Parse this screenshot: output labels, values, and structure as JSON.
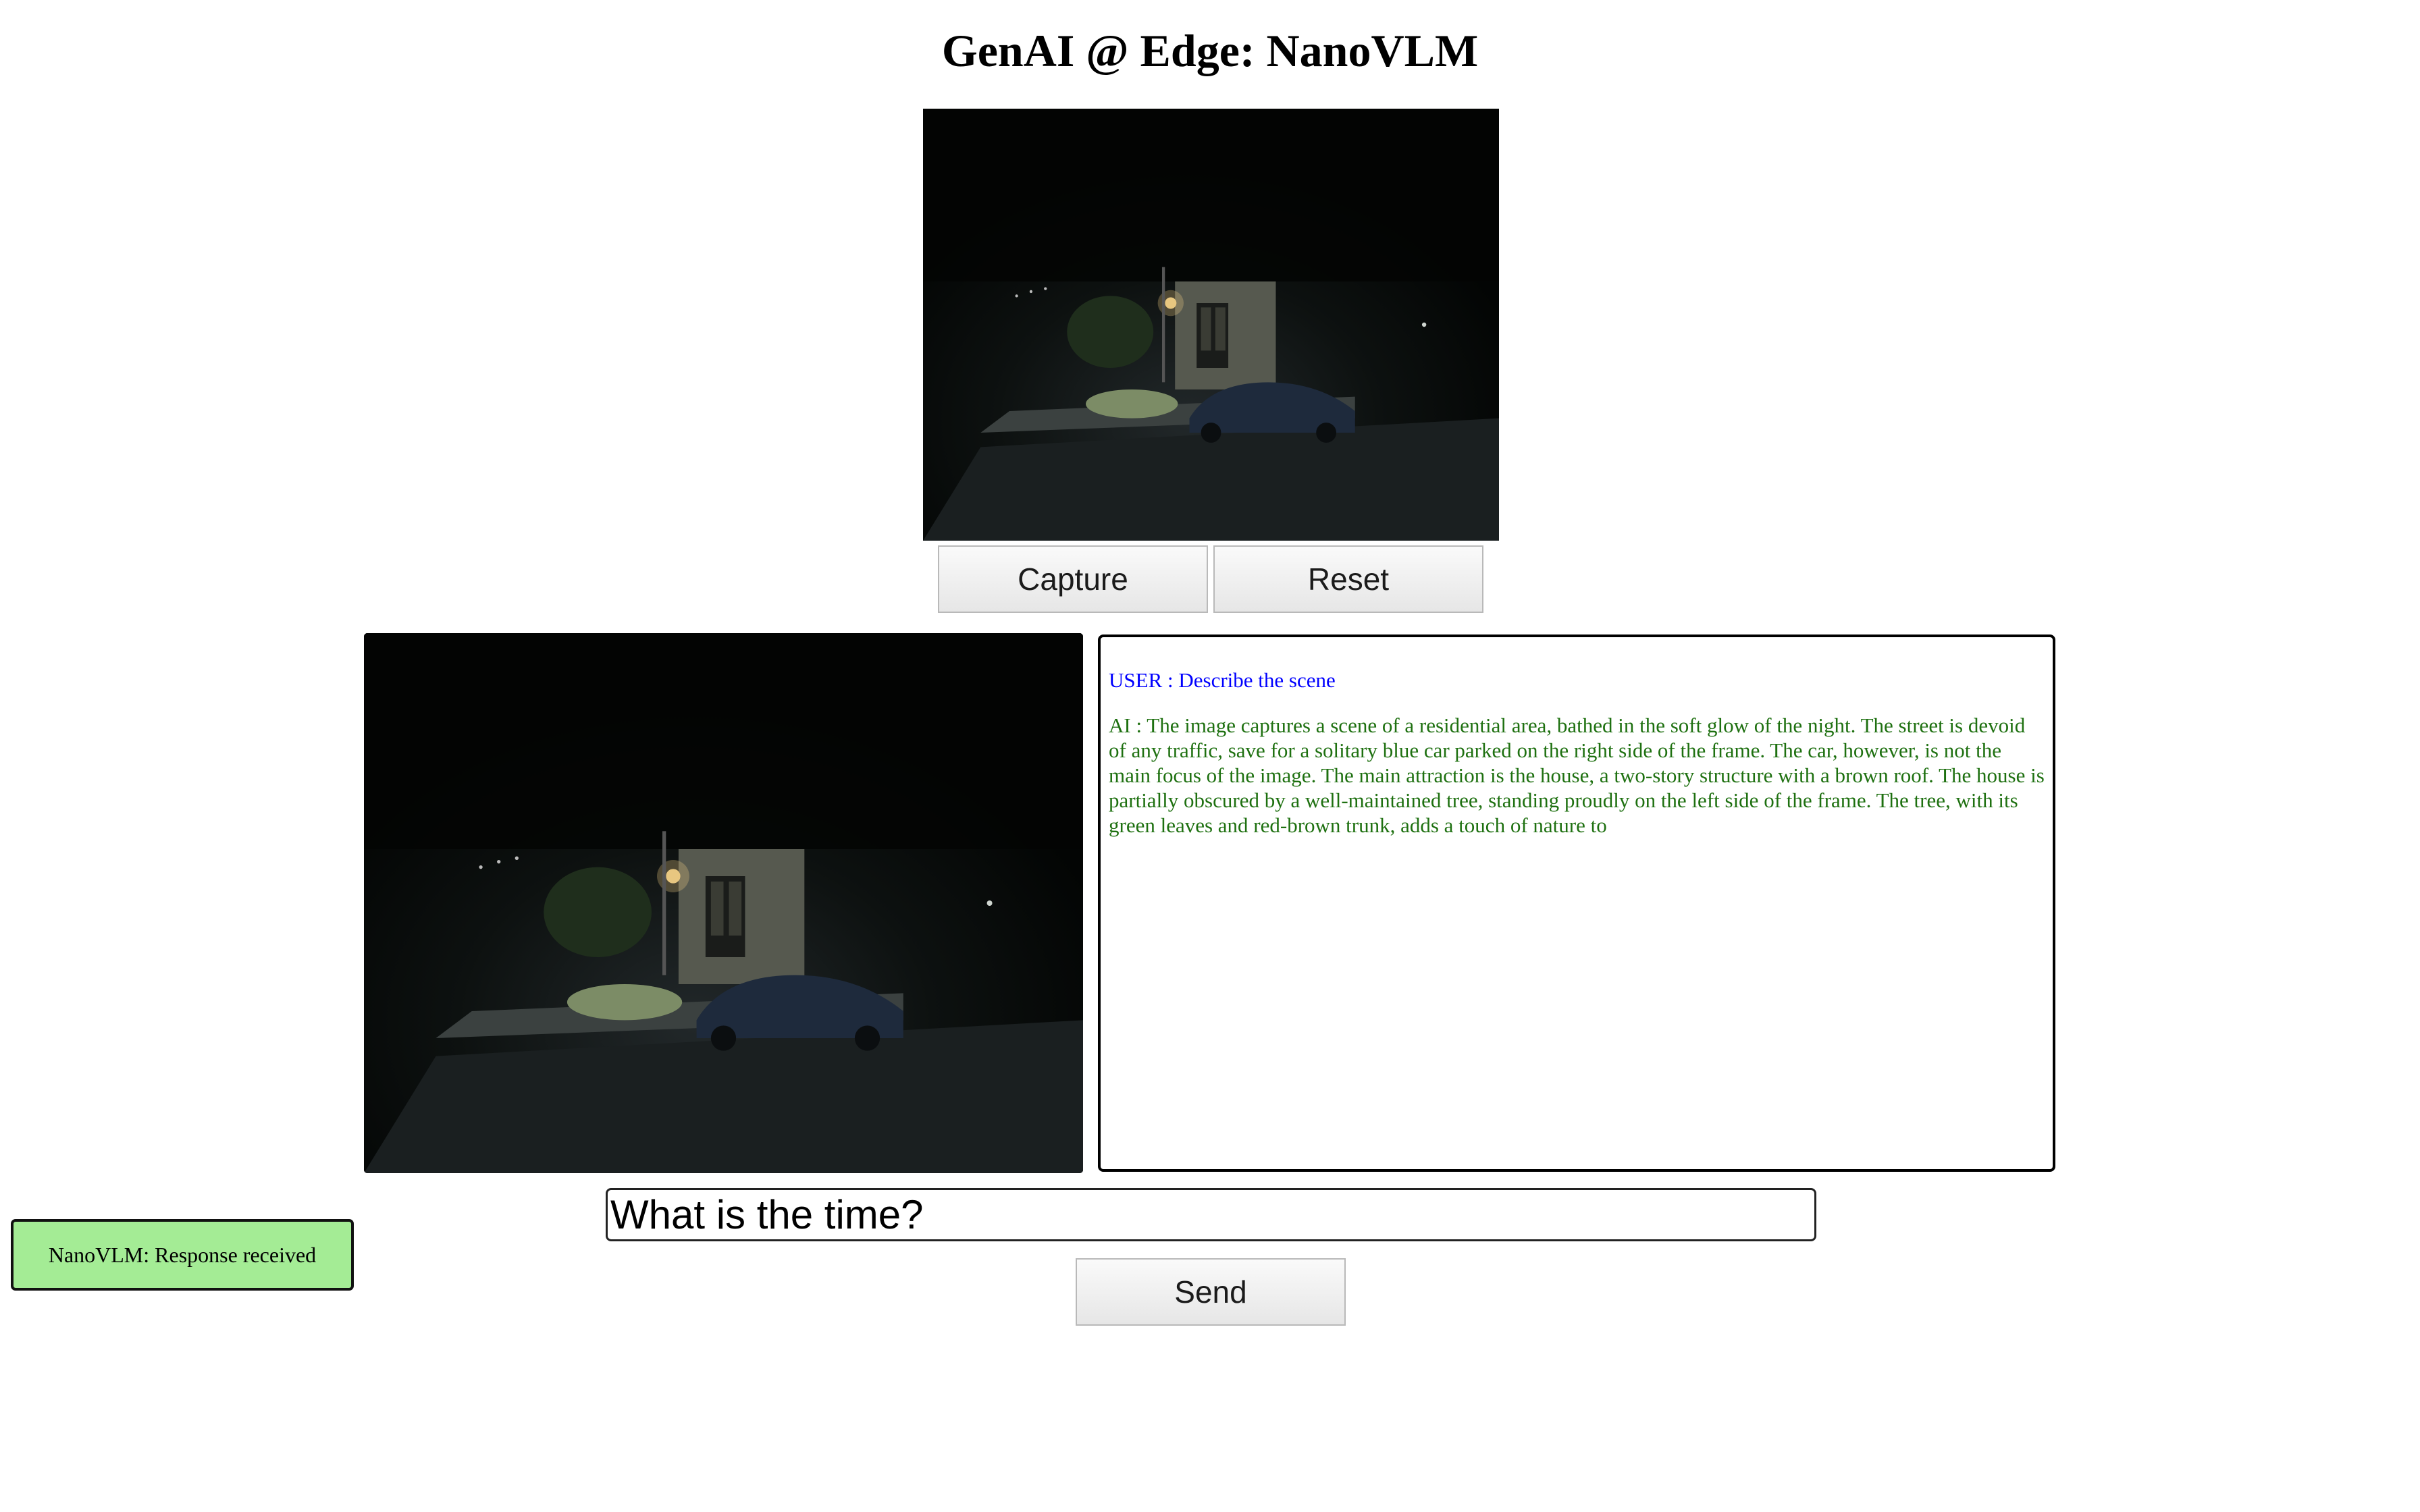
{
  "page": {
    "title": "GenAI @ Edge: NanoVLM"
  },
  "camera": {
    "capture_label": "Capture",
    "reset_label": "Reset"
  },
  "chat": {
    "messages": [
      {
        "role": "user",
        "text": "USER : Describe the scene"
      },
      {
        "role": "ai",
        "text": "AI : The image captures a scene of a residential area, bathed in the soft glow of the night. The street is devoid of any traffic, save for a solitary blue car parked on the right side of the frame. The car, however, is not the main focus of the image. The main attraction is the house, a two-story structure with a brown roof. The house is partially obscured by a well-maintained tree, standing proudly on the left side of the frame. The tree, with its green leaves and red-brown trunk, adds a touch of nature to"
      }
    ]
  },
  "input": {
    "value": "What is the time?"
  },
  "send": {
    "label": "Send"
  },
  "status": {
    "text": "NanoVLM: Response received"
  },
  "colors": {
    "user_text": "#0000ff",
    "ai_text": "#1e7010",
    "status_bg": "#a4ec95"
  }
}
